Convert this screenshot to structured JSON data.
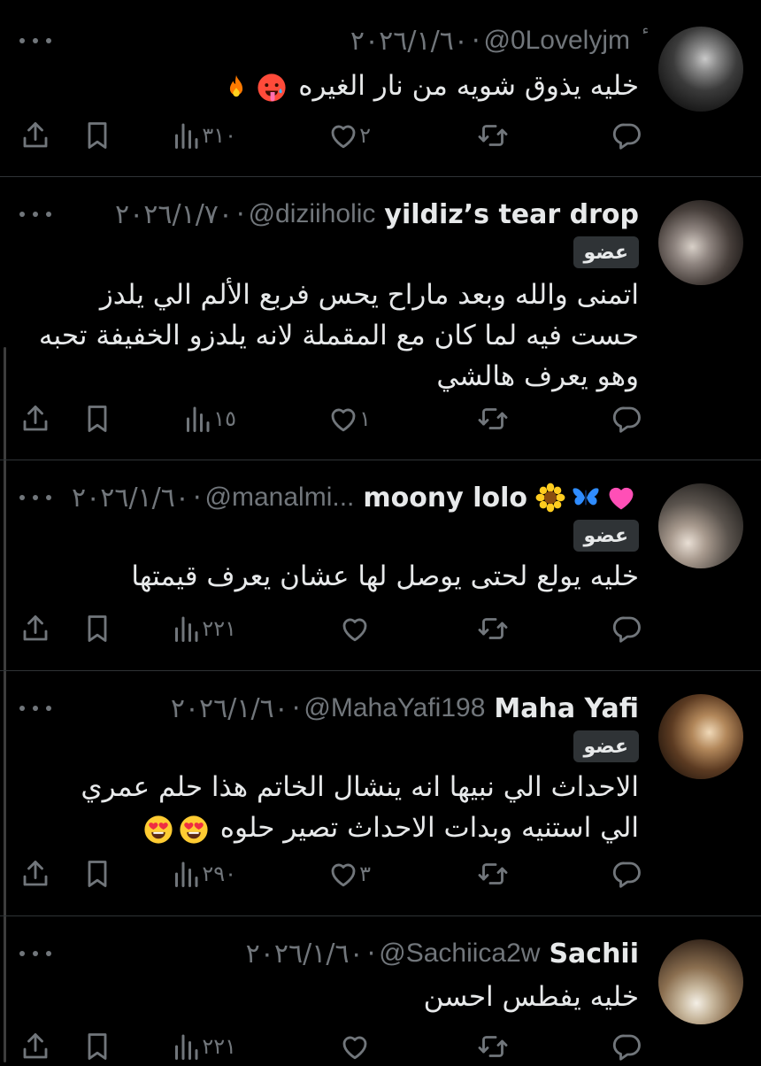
{
  "replies": [
    {
      "name": "",
      "handle": "@0Lovelyjm",
      "prefix": "ٔ",
      "date": "٢٠٢٦/١/٦٠",
      "badge": "",
      "text": "خليه يذوق شويه من نار الغيره",
      "text_emojis": [
        "hot-face",
        "fire"
      ],
      "stats": {
        "views": "٣١٠",
        "likes": "٢",
        "reposts": "",
        "replies": ""
      }
    },
    {
      "name": "yildiz’s tear drop",
      "handle": "@diziiholic",
      "date": "٢٠٢٦/١/٧٠",
      "badge": "عضو",
      "text": "اتمنى والله وبعد ماراح يحس فربع الألم الي يلدز حست فيه لما كان مع المقملة لانه يلدزو الخفيفة تحبه وهو يعرف هالشي",
      "stats": {
        "views": "١٥",
        "likes": "١",
        "reposts": "",
        "replies": ""
      }
    },
    {
      "name": "moony lolo",
      "name_emojis": [
        "pink-heart",
        "blue-butterfly",
        "sunflower"
      ],
      "handle": "@manalmi...",
      "date": "٢٠٢٦/١/٦٠",
      "badge": "عضو",
      "text": "خليه يولع  لحتى يوصل لها  عشان يعرف قيمتها",
      "stats": {
        "views": "٢٢١",
        "likes": "",
        "reposts": "",
        "replies": ""
      }
    },
    {
      "name": "Maha Yafi",
      "handle": "@MahaYafi198",
      "date": "٢٠٢٦/١/٦٠",
      "badge": "عضو",
      "text": "الاحداث الي نبيها انه ينشال الخاتم هذا حلم عمري الي استنيه وبدات الاحداث تصير حلوه",
      "text_emojis": [
        "heart-eyes",
        "heart-eyes"
      ],
      "stats": {
        "views": "٢٩٠",
        "likes": "٣",
        "reposts": "",
        "replies": ""
      }
    },
    {
      "name": "Sachii",
      "handle": "@Sachiica2w",
      "date": "٢٠٢٦/١/٦٠",
      "badge": "",
      "text": "خليه يفطس احسن",
      "stats": {
        "views": "٢٢١",
        "likes": "",
        "reposts": "",
        "replies": ""
      }
    }
  ],
  "colors": {
    "background": "#000000",
    "text": "#e7e9ea",
    "secondary": "#71767b",
    "divider": "#2f3336",
    "badge_bg": "#2f3336"
  }
}
